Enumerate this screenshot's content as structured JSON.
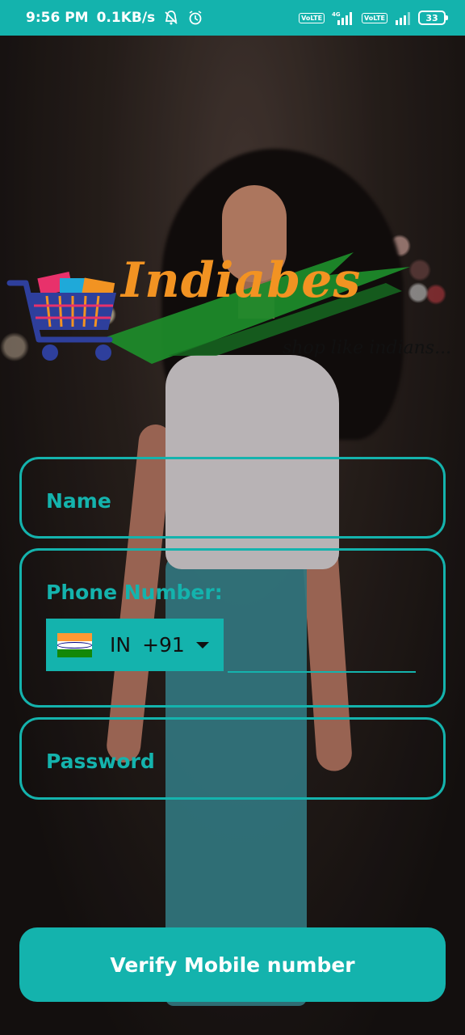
{
  "status_bar": {
    "time": "9:56 PM",
    "speed": "0.1KB/s",
    "network_1": "VoLTE",
    "network_type": "4G",
    "network_2": "VoLTE",
    "battery": "33"
  },
  "logo": {
    "brand": "Indiabes",
    "tagline": "shop like indians..."
  },
  "form": {
    "name_label": "Name",
    "phone_label": "Phone Number:",
    "country_iso": "IN",
    "country_code": "+91",
    "password_label": "Password"
  },
  "verify_button": "Verify Mobile number",
  "colors": {
    "accent": "#14b3ad",
    "logo_orange": "#f29322"
  }
}
